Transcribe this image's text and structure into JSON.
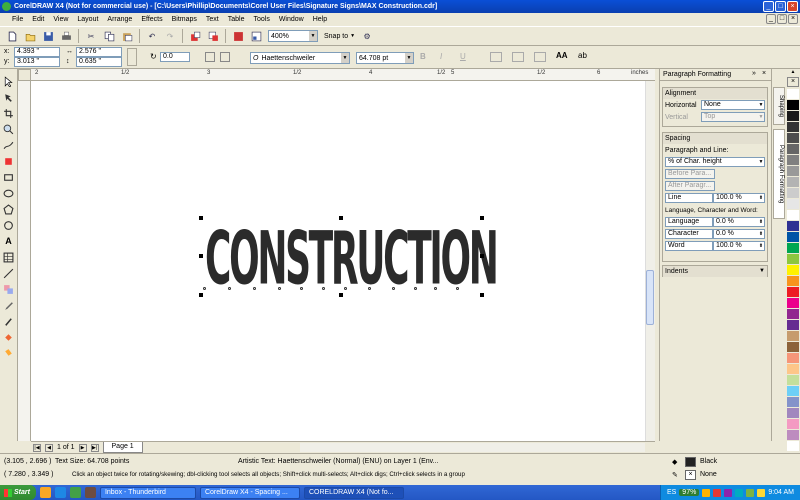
{
  "window": {
    "title": "CorelDRAW X4 (Not for commercial use) - [C:\\Users\\Phillip\\Documents\\Corel User Files\\Signature Signs\\MAX Construction.cdr]"
  },
  "menu": [
    "File",
    "Edit",
    "View",
    "Layout",
    "Arrange",
    "Effects",
    "Bitmaps",
    "Text",
    "Table",
    "Tools",
    "Window",
    "Help"
  ],
  "toolbar": {
    "zoom": "400%",
    "snap": "Snap to"
  },
  "propbar": {
    "x": "4.393 \"",
    "y": "3.013 \"",
    "w": "2.576 \"",
    "h": "0.635 \"",
    "x_label": "x:",
    "y_label": "y:",
    "angle": "0.0",
    "font": "Haettenschweiler",
    "size": "64.708 pt"
  },
  "ruler": {
    "h_ticks": [
      "2",
      "1/2",
      "3",
      "1/2",
      "4",
      "1/2",
      "5",
      "1/2",
      "6"
    ],
    "unit": "inches"
  },
  "canvas": {
    "text": "CONSTRUCTION"
  },
  "pagebar": {
    "page_count": "1 of 1",
    "page_tab": "Page 1"
  },
  "docker": {
    "title": "Paragraph Formatting",
    "alignment": {
      "head": "Alignment",
      "horizontal_label": "Horizontal",
      "horizontal": "None",
      "vertical_label": "Vertical",
      "vertical": "Top"
    },
    "spacing": {
      "head": "Spacing",
      "para_line_label": "Paragraph and Line:",
      "unit": "% of Char. height",
      "before": "Before Para...",
      "after": "After Paragr...",
      "line_label": "Line",
      "line": "100.0 %",
      "lang_char_word": "Language, Character and Word:",
      "language_label": "Language",
      "language": "0.0 %",
      "character_label": "Character",
      "character": "0.0 %",
      "word_label": "Word",
      "word": "100.0 %"
    },
    "indents": {
      "head": "Indents"
    }
  },
  "docker_tabs": [
    "Shaping",
    "Paragraph Formatting"
  ],
  "palette_colors": [
    "#ffffff",
    "#000000",
    "#1a1a1a",
    "#333333",
    "#4d4d4d",
    "#666666",
    "#808080",
    "#999999",
    "#b3b3b3",
    "#cccccc",
    "#e6e6e6",
    "#ffffff",
    "#2e3192",
    "#0054a6",
    "#00a651",
    "#8dc63f",
    "#fff200",
    "#f7941d",
    "#ed1c24",
    "#ec008c",
    "#92278f",
    "#662d91",
    "#c69c6d",
    "#8c6239",
    "#f69679",
    "#fdc689",
    "#c4df9b",
    "#6dcff6",
    "#8493ca",
    "#a187be",
    "#f49ac2",
    "#bd8cbf",
    "#ffffff"
  ],
  "status": {
    "coords": "(3.105 , 2.696 )",
    "text_size": "Text Size: 64.708 points",
    "object_info": "Artistic Text: Haettenschweiler (Normal) (ENU) on Layer 1  (Env...",
    "cursor": "( 7.280 , 3.349 )",
    "hint": "Click an object twice for rotating/skewing; dbl-clicking tool selects all objects; Shift+click multi-selects; Alt+click digs; Ctrl+click selects in a group",
    "fill_label": "Black",
    "outline_label": "None"
  },
  "taskbar": {
    "start": "Start",
    "tasks": [
      "Inbox - Thunderbird",
      "CorelDraw X4 - Spacing ...",
      "CORELDRAW X4 (Not fo..."
    ],
    "lang": "ES",
    "battery": "97%",
    "time": "9:04 AM"
  },
  "colors": {
    "title": "#0a4fd6",
    "accent": "#316ac5",
    "taskbar": "#2457c4"
  }
}
